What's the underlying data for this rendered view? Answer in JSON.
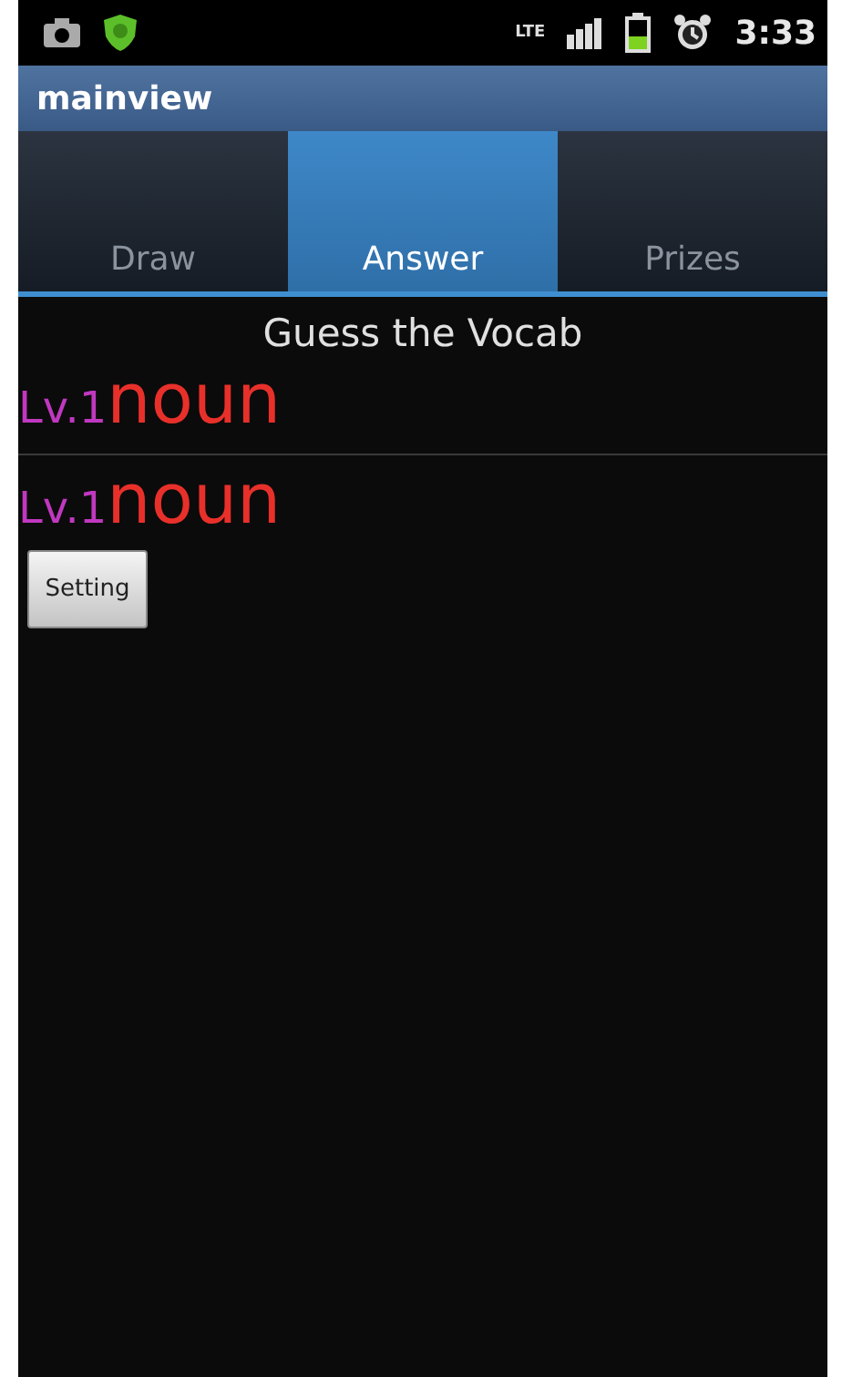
{
  "status_bar": {
    "time": "3:33",
    "network": "LTE"
  },
  "window": {
    "title": "mainview"
  },
  "tabs": [
    {
      "label": "Draw",
      "selected": false
    },
    {
      "label": "Answer",
      "selected": true
    },
    {
      "label": "Prizes",
      "selected": false
    }
  ],
  "heading": "Guess the Vocab",
  "entries": [
    {
      "level": "Lv.1",
      "word": "noun"
    },
    {
      "level": "Lv.1",
      "word": "noun"
    }
  ],
  "buttons": [
    "Setting"
  ]
}
